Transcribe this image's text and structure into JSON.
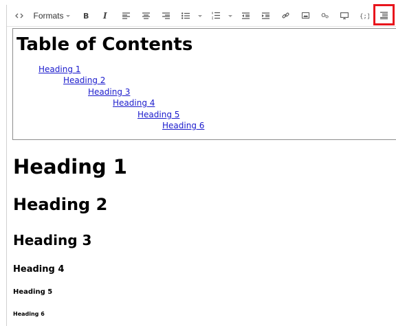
{
  "toolbar": {
    "formats_label": "Formats",
    "icons": [
      "source-code-icon",
      "formats-dropdown",
      "bold-icon",
      "italic-icon",
      "align-left-icon",
      "align-center-icon",
      "align-right-icon",
      "bullet-list-icon",
      "numbered-list-icon",
      "outdent-icon",
      "indent-icon",
      "link-icon",
      "image-icon",
      "media-icon",
      "preview-icon",
      "code-sample-icon",
      "table-of-contents-icon"
    ],
    "highlight_color": "#e8141c"
  },
  "toc": {
    "title": "Table of Contents",
    "links": [
      "Heading 1",
      "Heading 2",
      "Heading 3",
      "Heading 4",
      "Heading 5",
      "Heading 6"
    ],
    "link_color": "#1a1acc"
  },
  "content": {
    "headings": [
      "Heading 1",
      "Heading 2",
      "Heading 3",
      "Heading 4",
      "Heading 5",
      "Heading 6"
    ]
  }
}
